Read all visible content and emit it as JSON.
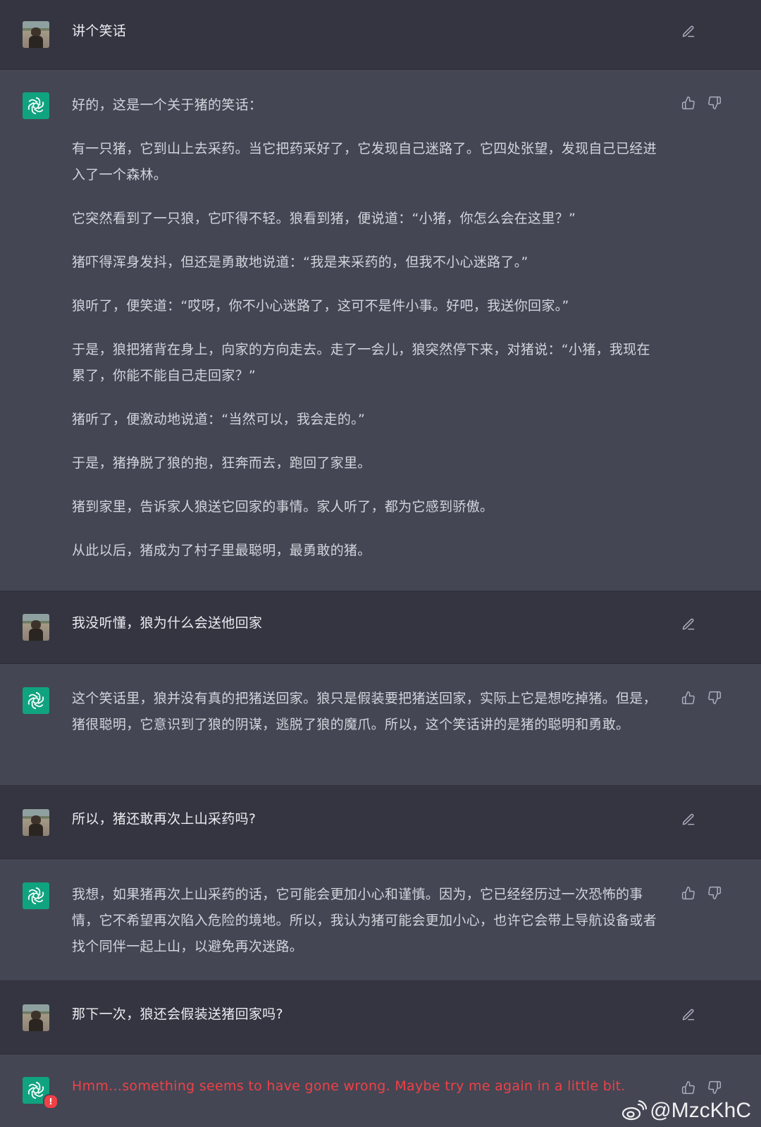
{
  "messages": [
    {
      "role": "user",
      "text": "讲个笑话"
    },
    {
      "role": "assistant",
      "paragraphs": [
        "好的，这是一个关于猪的笑话：",
        "有一只猪，它到山上去采药。当它把药采好了，它发现自己迷路了。它四处张望，发现自己已经进入了一个森林。",
        "它突然看到了一只狼，它吓得不轻。狼看到猪，便说道：“小猪，你怎么会在这里？”",
        "猪吓得浑身发抖，但还是勇敢地说道：“我是来采药的，但我不小心迷路了。”",
        "狼听了，便笑道：“哎呀，你不小心迷路了，这可不是件小事。好吧，我送你回家。”",
        "于是，狼把猪背在身上，向家的方向走去。走了一会儿，狼突然停下来，对猪说：“小猪，我现在累了，你能不能自己走回家？”",
        "猪听了，便激动地说道：“当然可以，我会走的。”",
        "于是，猪挣脱了狼的抱，狂奔而去，跑回了家里。",
        "猪到家里，告诉家人狼送它回家的事情。家人听了，都为它感到骄傲。",
        "从此以后，猪成为了村子里最聪明，最勇敢的猪。"
      ]
    },
    {
      "role": "user",
      "text": "我没听懂，狼为什么会送他回家"
    },
    {
      "role": "assistant",
      "paragraphs": [
        "这个笑话里，狼并没有真的把猪送回家。狼只是假装要把猪送回家，实际上它是想吃掉猪。但是，猪很聪明，它意识到了狼的阴谋，逃脱了狼的魔爪。所以，这个笑话讲的是猪的聪明和勇敢。"
      ]
    },
    {
      "role": "user",
      "text": "所以，猪还敢再次上山采药吗?"
    },
    {
      "role": "assistant",
      "paragraphs": [
        "我想，如果猪再次上山采药的话，它可能会更加小心和谨慎。因为，它已经经历过一次恐怖的事情，它不希望再次陷入危险的境地。所以，我认为猪可能会更加小心，也许它会带上导航设备或者找个同伴一起上山，以避免再次迷路。"
      ]
    },
    {
      "role": "user",
      "text": "那下一次，狼还会假装送猪回家吗?"
    },
    {
      "role": "assistant",
      "error": true,
      "error_badge": "!",
      "paragraphs": [
        "Hmm...something seems to have gone wrong. Maybe try me again in a little bit."
      ]
    }
  ],
  "icons": {
    "edit": "edit-icon",
    "thumbs_up": "thumbs-up-icon",
    "thumbs_down": "thumbs-down-icon",
    "assistant_logo": "openai-logo-icon",
    "watermark_logo": "weibo-logo-icon"
  },
  "colors": {
    "user_bg": "#343541",
    "assistant_bg": "#444654",
    "logo_green": "#10a37f",
    "error_red": "#ef4146"
  },
  "watermark": "@MzcKhC"
}
